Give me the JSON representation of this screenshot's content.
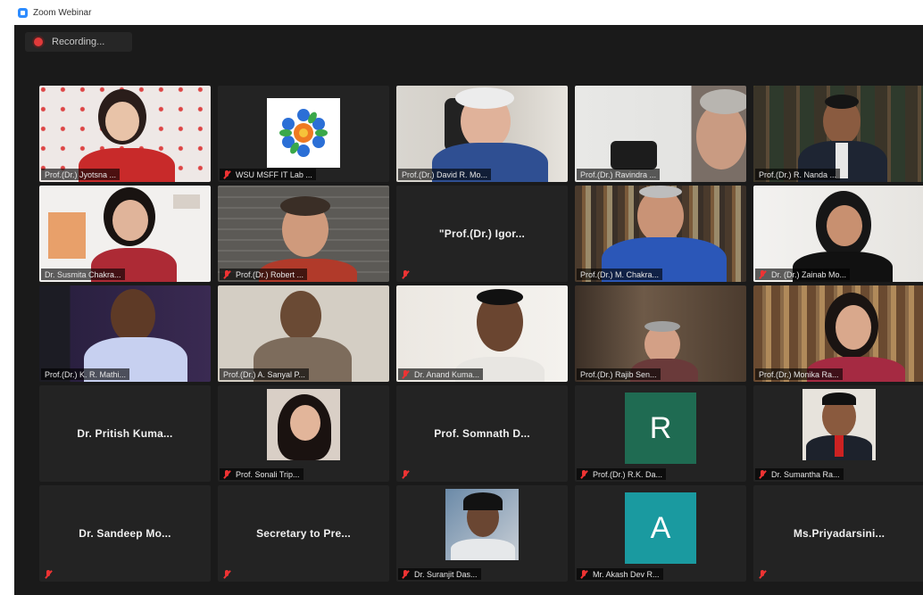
{
  "window": {
    "title": "Zoom Webinar"
  },
  "recording": {
    "label": "Recording..."
  },
  "colors": {
    "active_speaker": "#c8d23a",
    "mute_red": "#e33333",
    "avatar_r": "#1f6b52",
    "avatar_a": "#1a9aa0"
  },
  "rows": [
    [
      {
        "name": "Prof.(Dr.) Jyotsna ...",
        "muted": false
      },
      {
        "name": "WSU MSFF IT Lab ...",
        "muted": true
      },
      {
        "name": "Prof.(Dr.) David R. Mo...",
        "muted": false
      },
      {
        "name": "Prof.(Dr.) Ravindra ...",
        "muted": false
      },
      {
        "name": "Prof.(Dr.) R. Nanda ...",
        "muted": false,
        "active": true
      }
    ],
    [
      {
        "name": "Dr. Susmita Chakra...",
        "muted": false
      },
      {
        "name": "Prof.(Dr.) Robert ...",
        "muted": true
      },
      {
        "name": "\"Prof.(Dr.) Igor...",
        "muted": true,
        "center": true
      },
      {
        "name": "Prof.(Dr.) M. Chakra...",
        "muted": false
      },
      {
        "name": "Dr. (Dr.) Zainab Mo...",
        "muted": true
      }
    ],
    [
      {
        "name": "Prof.(Dr.) K. R. Mathi...",
        "muted": false
      },
      {
        "name": "Prof.(Dr.) A. Sanyal P...",
        "muted": false
      },
      {
        "name": "Dr. Anand Kuma...",
        "muted": true
      },
      {
        "name": "Prof.(Dr.) Rajib Sen...",
        "muted": false
      },
      {
        "name": "Prof.(Dr.) Monika Ra...",
        "muted": false
      }
    ],
    [
      {
        "name": "Dr. Pritish Kuma...",
        "muted": false,
        "center": true
      },
      {
        "name": "Prof. Sonali Trip...",
        "muted": true
      },
      {
        "name": "Prof. Somnath D...",
        "muted": true,
        "center": true
      },
      {
        "name": "Prof.(Dr.) R.K. Da...",
        "muted": true,
        "letter": "R"
      },
      {
        "name": "Dr. Sumantha Ra...",
        "muted": true
      }
    ],
    [
      {
        "name": "Dr. Sandeep Mo...",
        "muted": true,
        "center": true
      },
      {
        "name": "Secretary to Pre...",
        "muted": true,
        "center": true
      },
      {
        "name": "Dr. Suranjit Das...",
        "muted": true
      },
      {
        "name": "Mr. Akash Dev R...",
        "muted": true,
        "letter": "A"
      },
      {
        "name": "Ms.Priyadarsini...",
        "muted": true,
        "center": true
      }
    ]
  ]
}
